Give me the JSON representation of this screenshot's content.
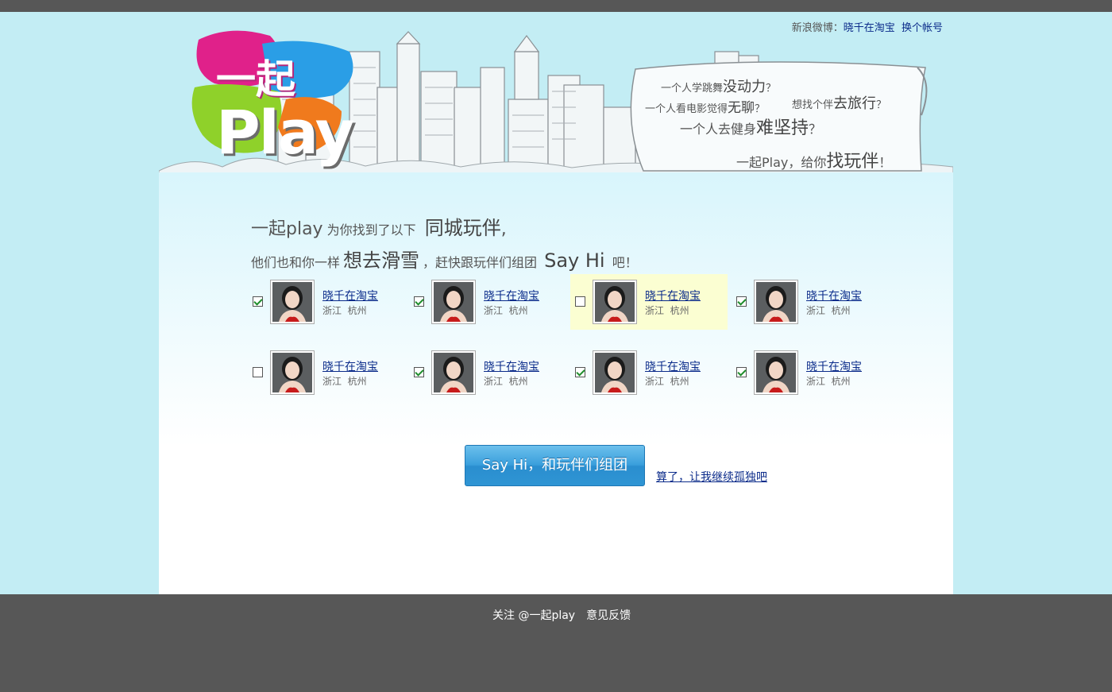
{
  "account": {
    "prefix": "新浪微博：",
    "username": "晓千在淘宝",
    "switch_label": "换个帐号"
  },
  "logo": {
    "top": "一起",
    "bottom": "Play"
  },
  "bubble": {
    "line1": {
      "pre": "一个人学跳舞",
      "em": "没动力",
      "post": "？"
    },
    "line2": {
      "pre": "一个人看电影觉得",
      "em": "无聊",
      "post": "？"
    },
    "line3": {
      "pre": "想找个伴",
      "em": "去旅行",
      "post": "？"
    },
    "line4": {
      "pre": "一个人去健身",
      "em": "难坚持",
      "post": "？"
    },
    "line5": {
      "pre": "一起Play，给你",
      "em": "找玩伴",
      "post": "！"
    }
  },
  "headline": {
    "p1": "一起play",
    "p2": " 为你找到了以下 ",
    "p3": "同城玩伴",
    "p4": ",",
    "p5": "他们也和你一样",
    "p6": "想去滑雪",
    "p7": "，赶快跟玩伴们组团 ",
    "p8": "Say Hi",
    "p9": " 吧！"
  },
  "friends": [
    {
      "name": "晓千在淘宝",
      "province": "浙江",
      "city": "杭州",
      "checked": true,
      "highlighted": false
    },
    {
      "name": "晓千在淘宝",
      "province": "浙江",
      "city": "杭州",
      "checked": true,
      "highlighted": false
    },
    {
      "name": "晓千在淘宝",
      "province": "浙江",
      "city": "杭州",
      "checked": false,
      "highlighted": true
    },
    {
      "name": "晓千在淘宝",
      "province": "浙江",
      "city": "杭州",
      "checked": true,
      "highlighted": false
    },
    {
      "name": "晓千在淘宝",
      "province": "浙江",
      "city": "杭州",
      "checked": false,
      "highlighted": false
    },
    {
      "name": "晓千在淘宝",
      "province": "浙江",
      "city": "杭州",
      "checked": true,
      "highlighted": false
    },
    {
      "name": "晓千在淘宝",
      "province": "浙江",
      "city": "杭州",
      "checked": true,
      "highlighted": false
    },
    {
      "name": "晓千在淘宝",
      "province": "浙江",
      "city": "杭州",
      "checked": true,
      "highlighted": false
    }
  ],
  "actions": {
    "sayhi_label": "Say Hi，和玩伴们组团",
    "skip_label": "算了，让我继续孤独吧"
  },
  "footer": {
    "follow_label": "关注 @一起play",
    "feedback_label": "意见反馈"
  },
  "colors": {
    "background": "#c3edf4",
    "link": "#0b2b8a",
    "footer": "#575757",
    "button": "#3a9fdc",
    "highlight": "#fbfed2"
  }
}
